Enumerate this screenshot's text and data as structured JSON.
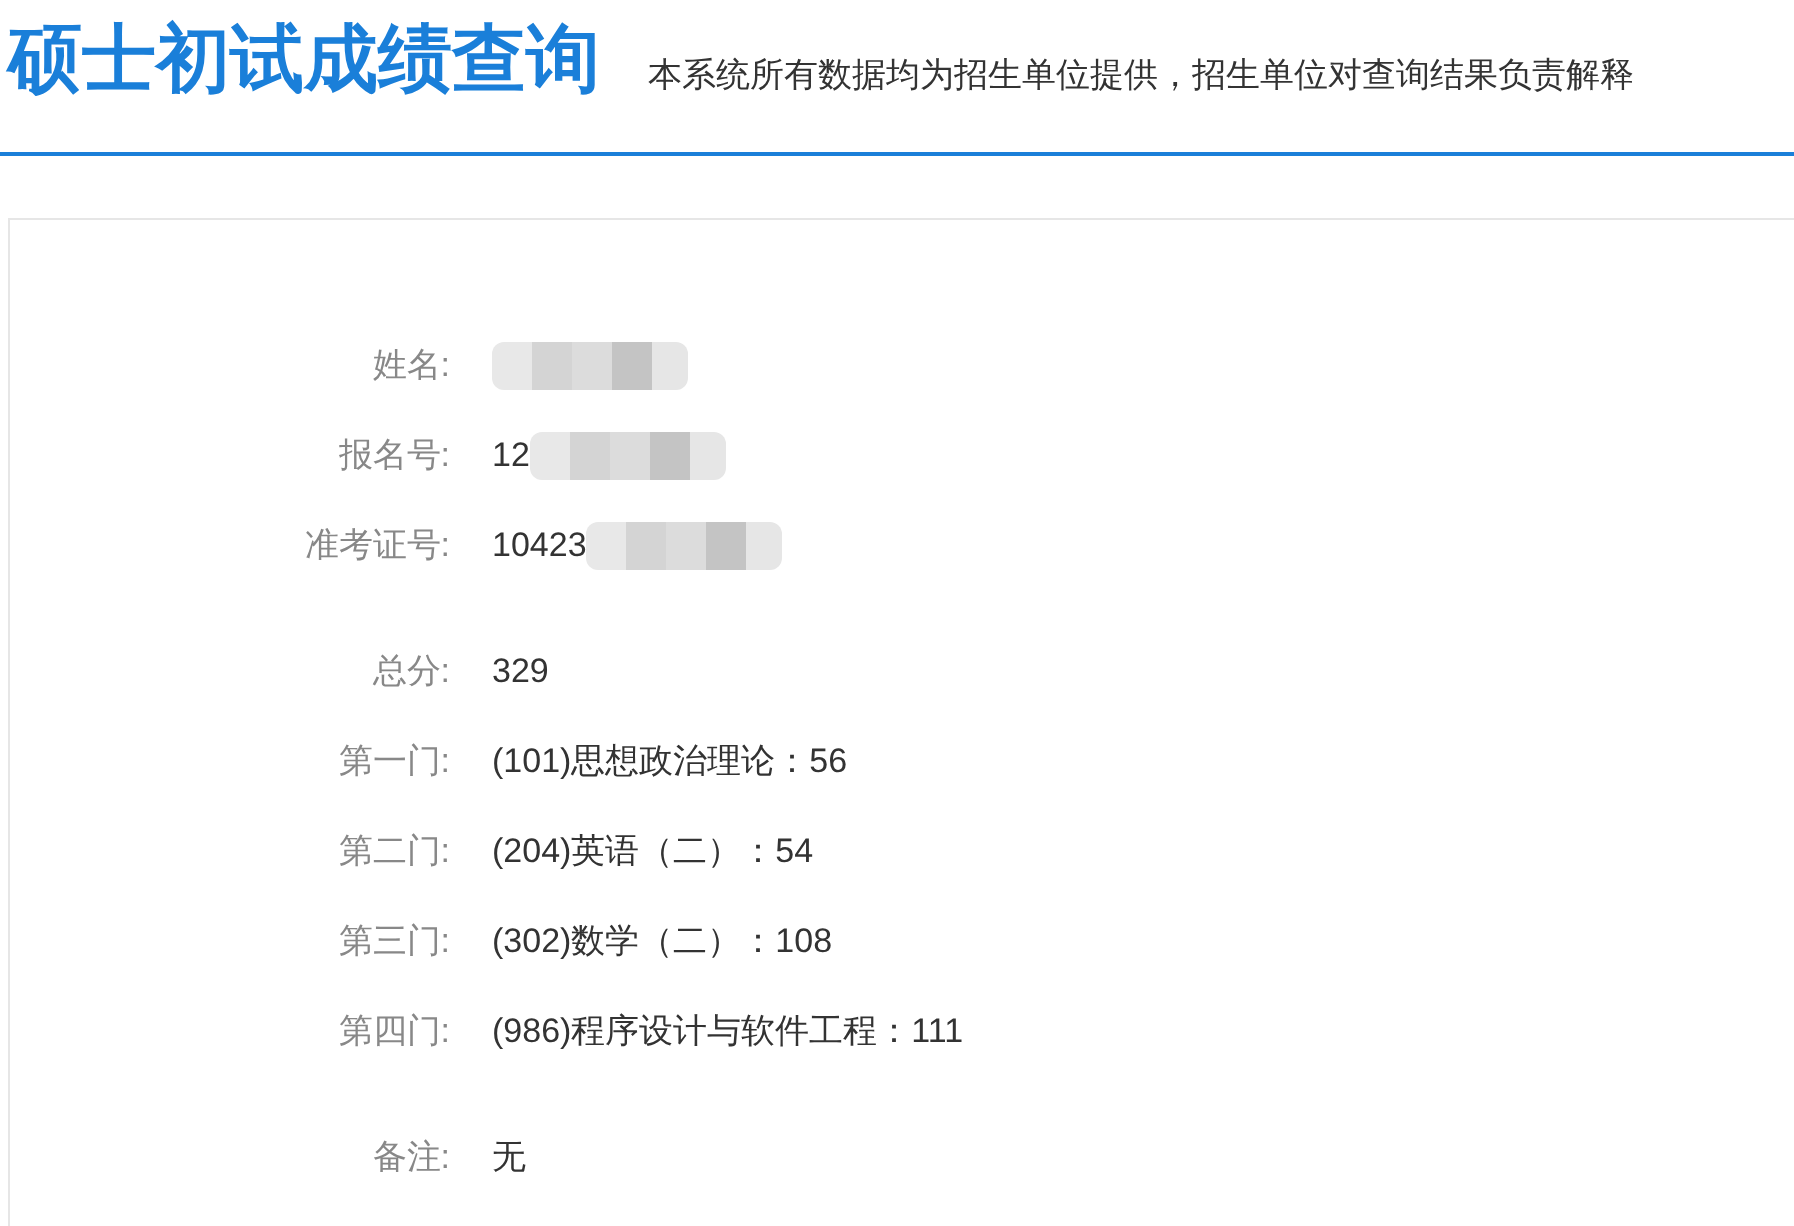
{
  "header": {
    "title": "硕士初试成绩查询",
    "notice": "本系统所有数据均为招生单位提供，招生单位对查询结果负责解释"
  },
  "groups": [
    {
      "rows": [
        {
          "label": "姓名:",
          "value": "",
          "redacted": true
        },
        {
          "label": "报名号:",
          "value": "12",
          "redacted": true
        },
        {
          "label": "准考证号:",
          "value": "10423",
          "redacted": true
        }
      ]
    },
    {
      "rows": [
        {
          "label": "总分:",
          "value": "329",
          "redacted": false
        },
        {
          "label": "第一门:",
          "value": "(101)思想政治理论：56",
          "redacted": false
        },
        {
          "label": "第二门:",
          "value": "(204)英语（二）：54",
          "redacted": false
        },
        {
          "label": "第三门:",
          "value": "(302)数学（二）：108",
          "redacted": false
        },
        {
          "label": "第四门:",
          "value": "(986)程序设计与软件工程：111",
          "redacted": false
        }
      ]
    },
    {
      "rows": [
        {
          "label": "备注:",
          "value": "无",
          "redacted": false
        }
      ]
    }
  ]
}
